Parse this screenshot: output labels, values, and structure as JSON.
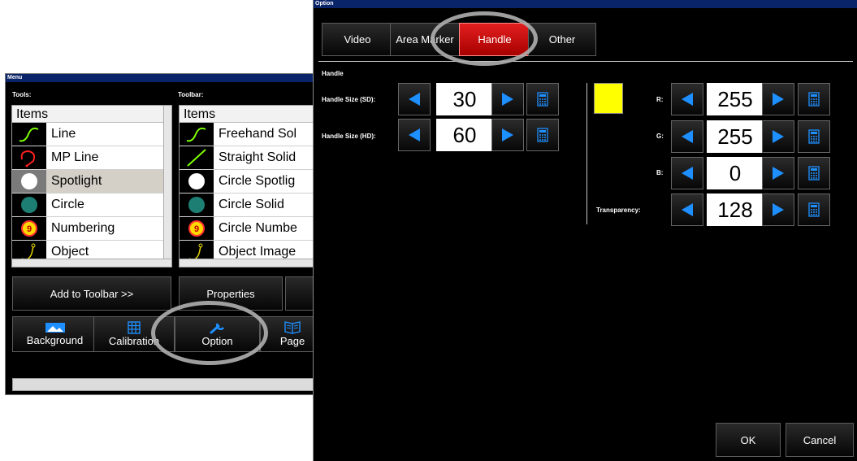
{
  "menu": {
    "title": "Menu",
    "tools_label": "Tools:",
    "toolbar_label": "Toolbar:",
    "tools_list": {
      "header": "Items",
      "items": [
        {
          "label": "Line",
          "icon": "curve-line-icon"
        },
        {
          "label": "MP Line",
          "icon": "mp-line-icon"
        },
        {
          "label": "Spotlight",
          "icon": "spotlight-icon"
        },
        {
          "label": "Circle",
          "icon": "circle-icon"
        },
        {
          "label": "Numbering",
          "icon": "numbering-icon"
        },
        {
          "label": "Object",
          "icon": "object-icon"
        }
      ]
    },
    "toolbar_list": {
      "header": "Items",
      "items": [
        {
          "label": "Freehand Sol",
          "icon": "curve-line-icon"
        },
        {
          "label": "Straight Solid",
          "icon": "straight-line-icon"
        },
        {
          "label": "Circle Spotlig",
          "icon": "spotlight-icon"
        },
        {
          "label": "Circle Solid",
          "icon": "circle-icon"
        },
        {
          "label": "Circle Numbe",
          "icon": "numbering-icon"
        },
        {
          "label": "Object Image",
          "icon": "object-icon"
        }
      ]
    },
    "add_to_toolbar": "Add to Toolbar >>",
    "properties": "Properties",
    "bottom_buttons": {
      "background": "Background",
      "calibration": "Calibration",
      "option": "Option",
      "page": "Page"
    }
  },
  "option": {
    "title": "Option",
    "tabs": {
      "video": "Video",
      "area_marker": "Area Marker",
      "handle": "Handle",
      "other": "Other"
    },
    "section_title": "Handle",
    "handle_size_sd": {
      "label": "Handle Size (SD):",
      "value": "30"
    },
    "handle_size_hd": {
      "label": "Handle Size (HD):",
      "value": "60"
    },
    "swatch_color": "#ffff00",
    "r": {
      "label": "R:",
      "value": "255"
    },
    "g": {
      "label": "G:",
      "value": "255"
    },
    "b": {
      "label": "B:",
      "value": "0"
    },
    "transparency": {
      "label": "Transparency:",
      "value": "128"
    },
    "ok": "OK",
    "cancel": "Cancel"
  },
  "colors": {
    "arrow_blue": "#1e8fff",
    "active_tab": "#cc0000",
    "swatch": "#ffff00"
  }
}
